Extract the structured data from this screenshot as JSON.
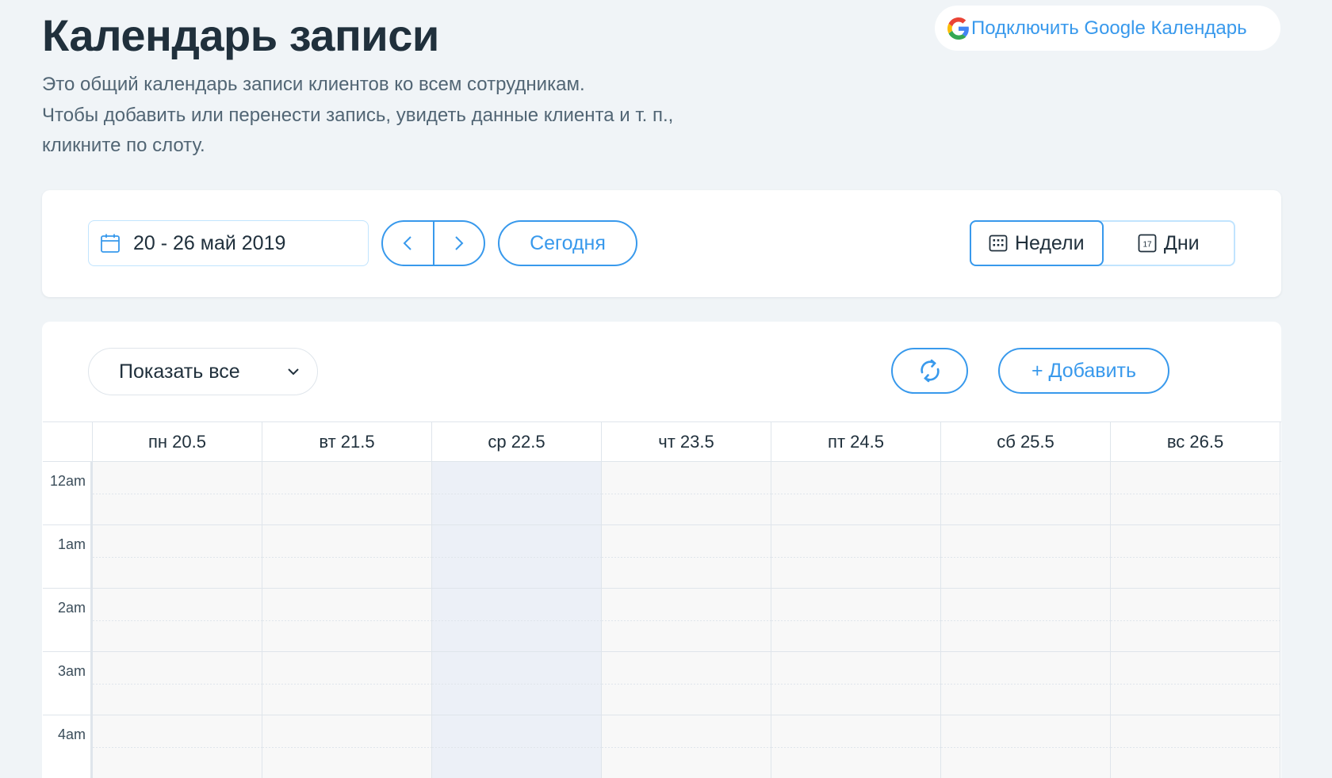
{
  "header": {
    "title": "Календарь записи",
    "description": [
      "Это общий календарь записи клиентов ко всем сотрудникам.",
      "Чтобы добавить или перенести запись, увидеть данные клиента и т. п.,",
      "кликните по слоту."
    ],
    "google_button": "Подключить Google Календарь"
  },
  "toolbar": {
    "date_range": "20 - 26 май 2019",
    "today_label": "Сегодня",
    "view_week_label": "Недели",
    "view_day_label": "Дни",
    "day_icon_number": "17",
    "active_view": "week"
  },
  "calendar": {
    "filter_label": "Показать все",
    "add_label": "+ Добавить",
    "days": [
      "пн 20.5",
      "вт 21.5",
      "ср 22.5",
      "чт 23.5",
      "пт 24.5",
      "сб 25.5",
      "вс 26.5"
    ],
    "highlighted_day": "ср 22.5",
    "hours": [
      "12am",
      "1am",
      "2am",
      "3am",
      "4am"
    ]
  },
  "colors": {
    "accent": "#3899ec",
    "background": "#f0f4f7",
    "title": "#20303c",
    "today_column": "#ecf0f7"
  }
}
